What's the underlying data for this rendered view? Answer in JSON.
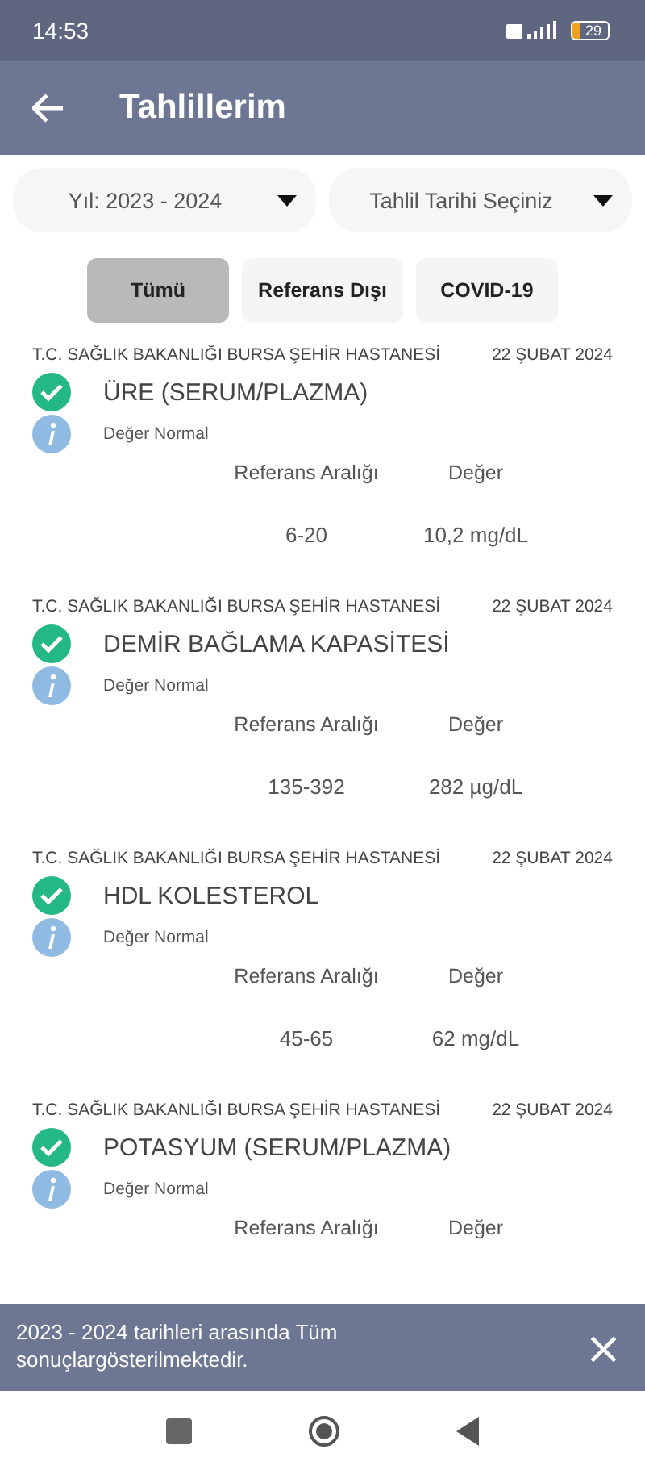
{
  "status_bar": {
    "time": "14:53",
    "battery": "29"
  },
  "header": {
    "title": "Tahlillerim"
  },
  "filters": [
    {
      "label": "Yıl: 2023 - 2024"
    },
    {
      "label": "Tahlil Tarihi Seçiniz"
    }
  ],
  "tabs": [
    {
      "label": "Tümü",
      "selected": true
    },
    {
      "label": "Referans Dışı",
      "selected": false
    },
    {
      "label": "COVID-19",
      "selected": false
    }
  ],
  "results": [
    {
      "hospital": "T.C. SAĞLIK BAKANLIĞI BURSA ŞEHİR HASTANESİ",
      "date": "22 ŞUBAT 2024",
      "test": "ÜRE (SERUM/PLAZMA)",
      "normal": true,
      "status": "Değer Normal",
      "range_label": "Referans Aralığı",
      "value_label": "Değer",
      "range": "6-20",
      "value": "10,2 mg/dL"
    },
    {
      "hospital": "T.C. SAĞLIK BAKANLIĞI BURSA ŞEHİR HASTANESİ",
      "date": "22 ŞUBAT 2024",
      "test": "DEMİR BAĞLAMA KAPASİTESİ",
      "normal": true,
      "status": "Değer Normal",
      "range_label": "Referans Aralığı",
      "value_label": "Değer",
      "range": "135-392",
      "value": "282 µg/dL"
    },
    {
      "hospital": "T.C. SAĞLIK BAKANLIĞI BURSA ŞEHİR HASTANESİ",
      "date": "22 ŞUBAT 2024",
      "test": "HDL KOLESTEROL",
      "normal": true,
      "status": "Değer Normal",
      "range_label": "Referans Aralığı",
      "value_label": "Değer",
      "range": "45-65",
      "value": "62 mg/dL"
    },
    {
      "hospital": "T.C. SAĞLIK BAKANLIĞI BURSA ŞEHİR HASTANESİ",
      "date": "22 ŞUBAT 2024",
      "test": "POTASYUM (SERUM/PLAZMA)",
      "normal": true,
      "status": "Değer Normal",
      "range_label": "Referans Aralığı",
      "value_label": "Değer"
    }
  ],
  "snackbar": {
    "message": "2023 - 2024 tarihleri arasında Tüm sonuçlargösterilmektedir.",
    "close": "×"
  }
}
